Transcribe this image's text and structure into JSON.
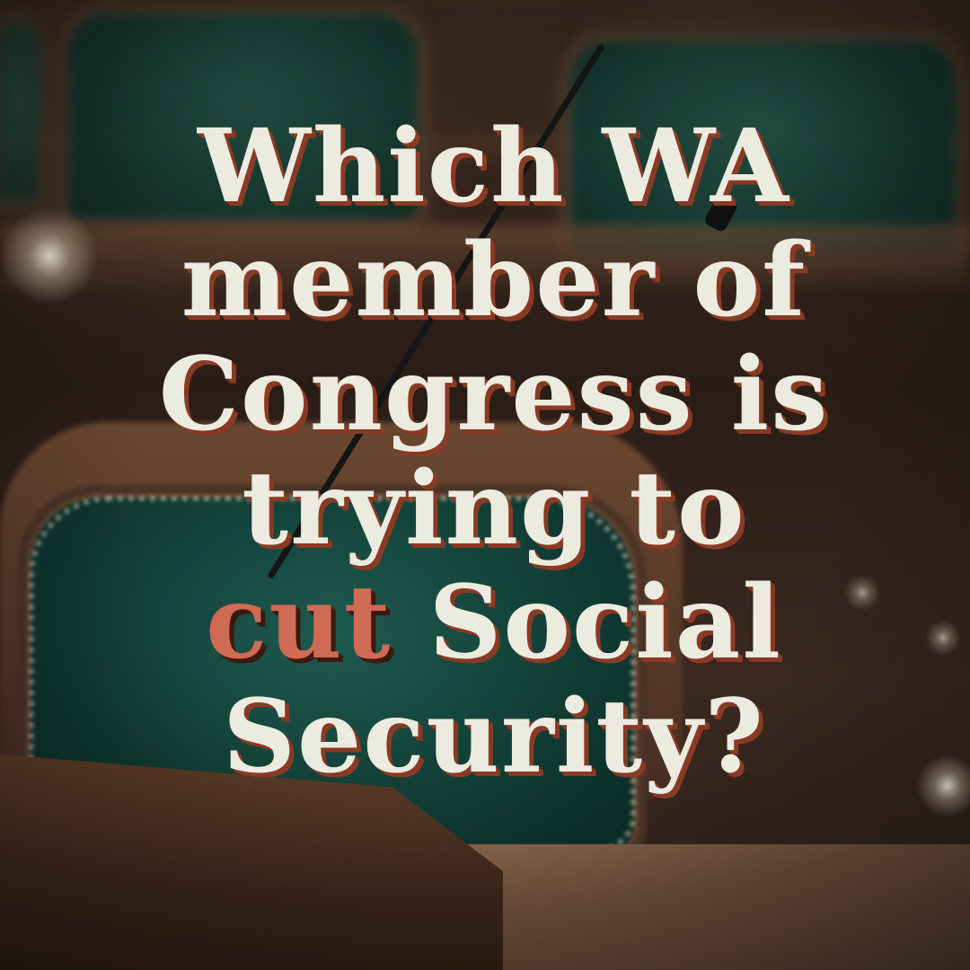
{
  "headline": {
    "line1": "Which WA",
    "line2": "member of",
    "line3": "Congress is",
    "line4": "trying to",
    "line5_accent": "cut",
    "line5_rest": " Social",
    "line6": "Security?"
  },
  "colors": {
    "text": "#ecebdf",
    "text_shadow": "#8a3a24",
    "accent": "#cf6a55",
    "chair_upholstery": "#0f3a32",
    "wood": "#5c3c28"
  }
}
